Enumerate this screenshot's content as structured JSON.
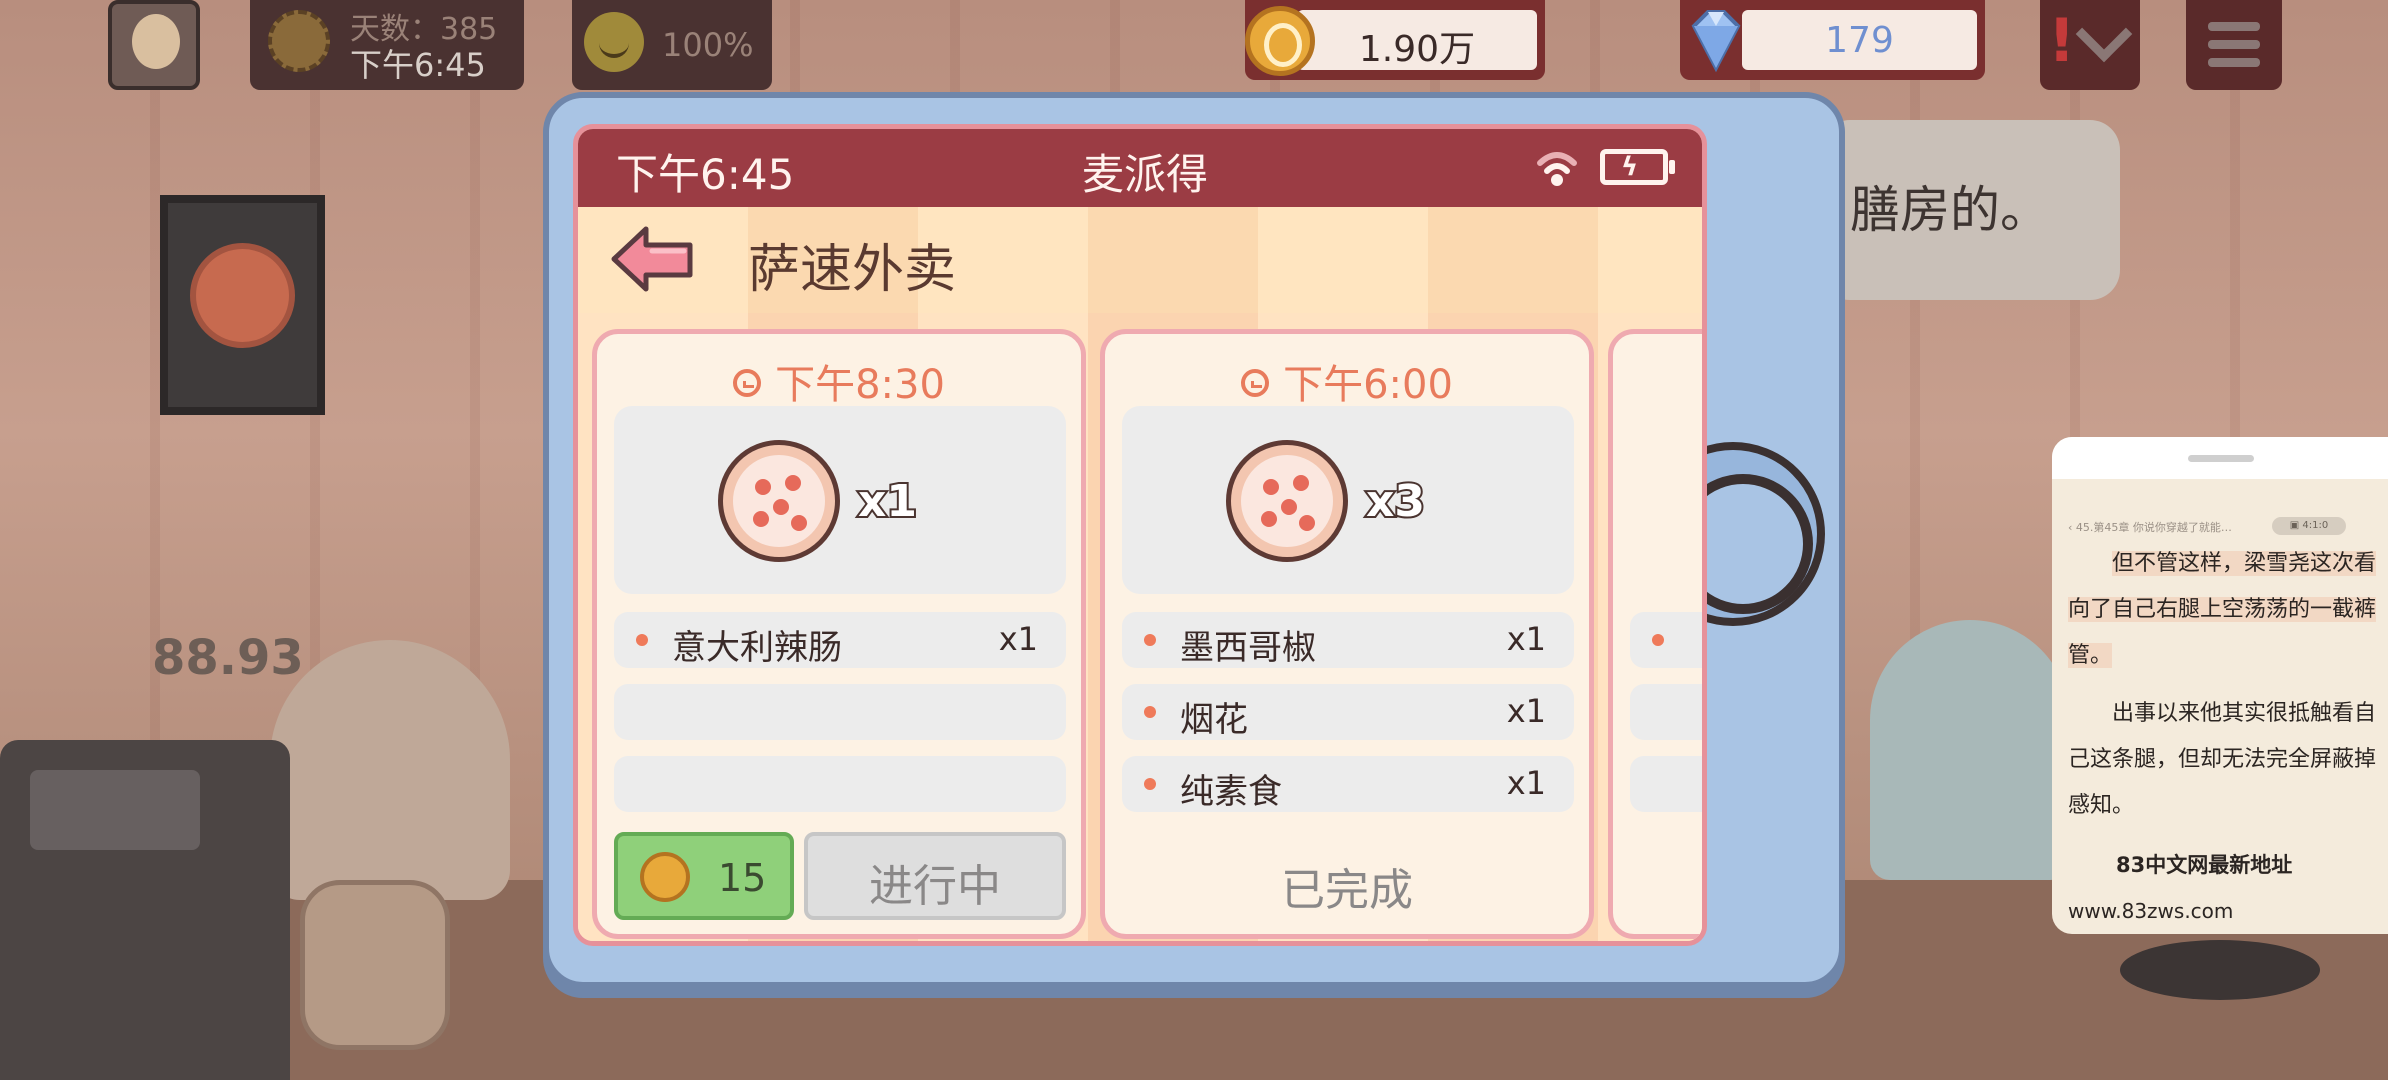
{
  "hud": {
    "day_count": "天数：385",
    "time": "下午6:45",
    "mood_percent": "100%",
    "coins": "1.90万",
    "gems": "179"
  },
  "scene": {
    "speech_text": "膳房的。",
    "floating_number": "88.93"
  },
  "phone": {
    "status_time": "下午6:45",
    "status_title": "麦派得",
    "app_title": "萨速外卖",
    "orders": [
      {
        "time": "下午8:30",
        "pizza_qty": "x1",
        "items": [
          {
            "name": "意大利辣肠",
            "qty": "x1"
          }
        ],
        "reward": "15",
        "status": "进行中"
      },
      {
        "time": "下午6:00",
        "pizza_qty": "x3",
        "items": [
          {
            "name": "墨西哥椒",
            "qty": "x1"
          },
          {
            "name": "烟花",
            "qty": "x1"
          },
          {
            "name": "纯素食",
            "qty": "x1"
          }
        ],
        "status": "已完成"
      }
    ]
  },
  "reader": {
    "chapter_path": "‹ 45.第45章 你说你穿越了就能…",
    "chip_label": "▣ 4:1:0",
    "para1_a": "但不管这样，梁雪尧这次看向了自己右腿上空荡荡的一截裤管。",
    "para2": "出事以来他其实很抵触看自己这条腿，但却无法完全屏蔽掉感知。",
    "site_name": "83中文网最新地址",
    "site_url": "www.83zws.com"
  },
  "colors": {
    "status_bar": "#9b3c44",
    "card_border": "#efaab0",
    "reward_green": "#8fd07a",
    "gem_text": "#6f8fd0",
    "order_time": "#e87b5c"
  },
  "icons": [
    "sun-icon",
    "mood-icon",
    "coin-icon",
    "gem-icon",
    "alert-icon",
    "chevron-down-icon",
    "menu-icon",
    "wifi-icon",
    "battery-icon",
    "back-arrow-icon",
    "clock-icon",
    "pizza-icon",
    "home-button"
  ]
}
